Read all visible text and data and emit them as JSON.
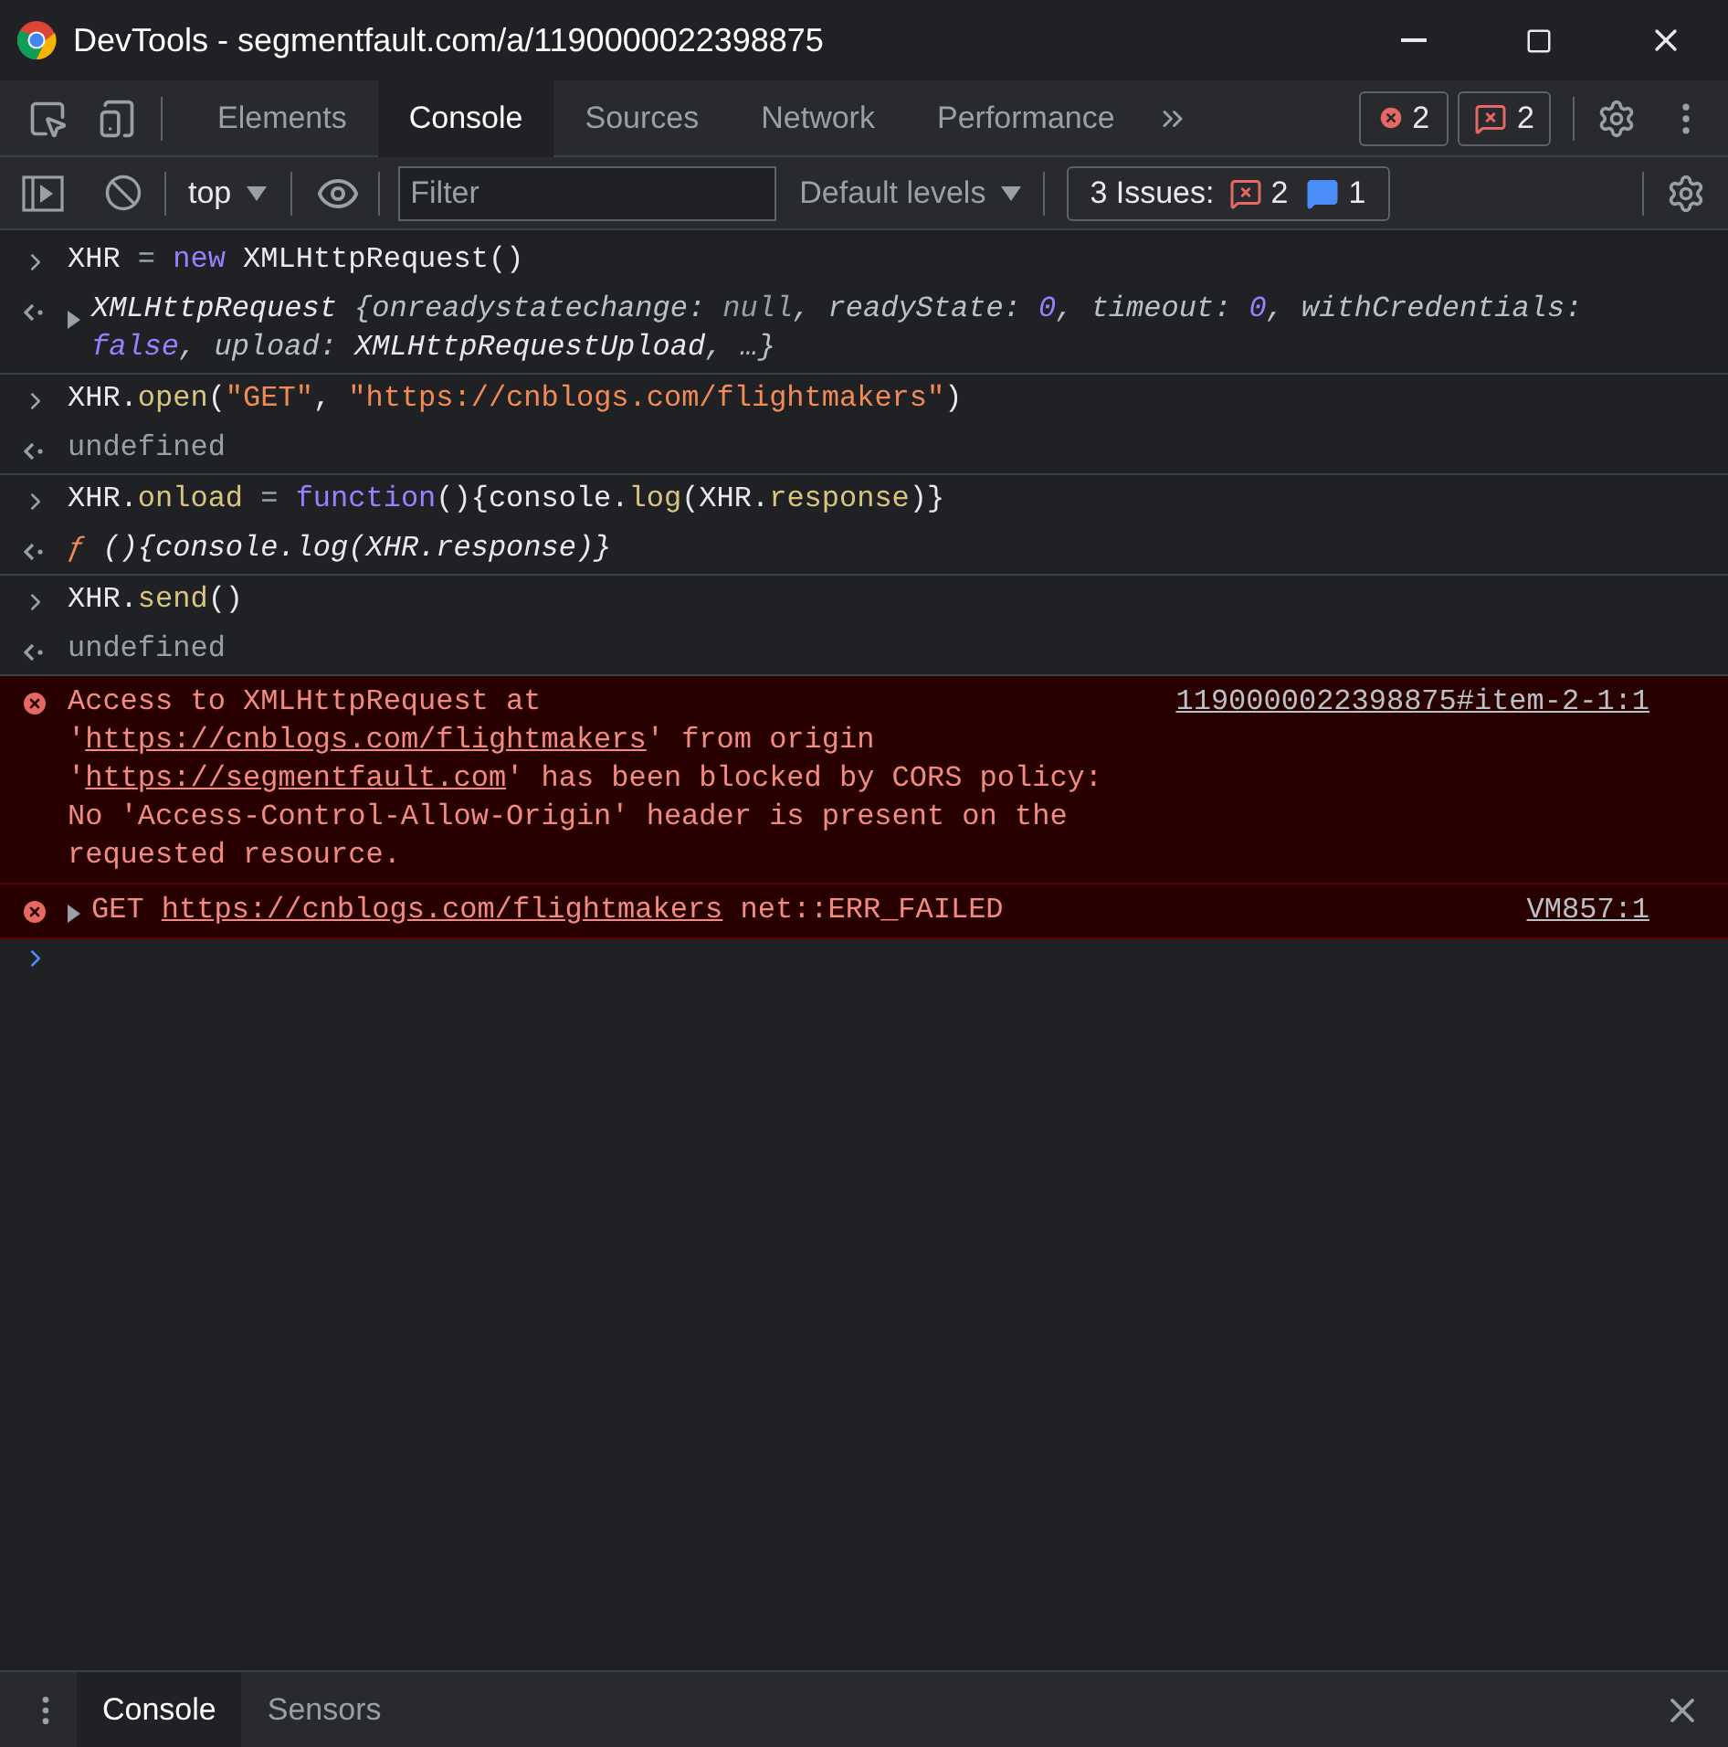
{
  "window": {
    "title": "DevTools - segmentfault.com/a/1190000022398875"
  },
  "toolbar": {
    "tabs": [
      {
        "label": "Elements",
        "selected": false
      },
      {
        "label": "Console",
        "selected": true
      },
      {
        "label": "Sources",
        "selected": false
      },
      {
        "label": "Network",
        "selected": false
      },
      {
        "label": "Performance",
        "selected": false
      }
    ],
    "error_count": "2",
    "issue_count": "2"
  },
  "console_toolbar": {
    "context": "top",
    "filter": {
      "placeholder": "Filter"
    },
    "levels": "Default levels",
    "issues": {
      "label": "3 Issues:",
      "errors": "2",
      "info": "1"
    }
  },
  "entries": [
    {
      "kind": "input",
      "tokens": [
        {
          "kind": "plain",
          "text": "XHR"
        },
        {
          "kind": "op",
          "text": " = "
        },
        {
          "kind": "keyword",
          "text": "new"
        },
        {
          "kind": "plain",
          "text": " XMLHttpRequest()"
        }
      ]
    },
    {
      "kind": "result",
      "expandable": true,
      "italic": true,
      "tokens": [
        {
          "kind": "plain",
          "text": "XMLHttpRequest "
        },
        {
          "kind": "dim",
          "text": "{onreadystatechange: "
        },
        {
          "kind": "null",
          "text": "null"
        },
        {
          "kind": "dim",
          "text": ", readyState: "
        },
        {
          "kind": "number",
          "text": "0"
        },
        {
          "kind": "dim",
          "text": ", timeout: "
        },
        {
          "kind": "number",
          "text": "0"
        },
        {
          "kind": "dim",
          "text": ", withCredentials: "
        },
        {
          "kind": "number",
          "text": "false"
        },
        {
          "kind": "dim",
          "text": ", upload: "
        },
        {
          "kind": "plain",
          "text": "XMLHttpRequestUpload"
        },
        {
          "kind": "dim",
          "text": ", …}"
        }
      ]
    },
    {
      "kind": "input",
      "tokens": [
        {
          "kind": "plain",
          "text": "XHR."
        },
        {
          "kind": "method",
          "text": "open"
        },
        {
          "kind": "plain",
          "text": "("
        },
        {
          "kind": "string",
          "text": "\"GET\""
        },
        {
          "kind": "plain",
          "text": ", "
        },
        {
          "kind": "string",
          "text": "\"https://cnblogs.com/flightmakers\""
        },
        {
          "kind": "plain",
          "text": ")"
        }
      ]
    },
    {
      "kind": "result",
      "expandable": false,
      "italic": false,
      "tokens": [
        {
          "kind": "null",
          "text": "undefined"
        }
      ]
    },
    {
      "kind": "input",
      "tokens": [
        {
          "kind": "plain",
          "text": "XHR."
        },
        {
          "kind": "method",
          "text": "onload"
        },
        {
          "kind": "op",
          "text": " = "
        },
        {
          "kind": "keyword",
          "text": "function"
        },
        {
          "kind": "plain",
          "text": "(){console."
        },
        {
          "kind": "method",
          "text": "log"
        },
        {
          "kind": "plain",
          "text": "(XHR."
        },
        {
          "kind": "method",
          "text": "response"
        },
        {
          "kind": "plain",
          "text": ")}"
        }
      ]
    },
    {
      "kind": "result",
      "expandable": false,
      "italic": true,
      "tokens": [
        {
          "kind": "string",
          "text": "ƒ"
        },
        {
          "kind": "plain",
          "text": " (){console.log(XHR.response)}"
        }
      ]
    },
    {
      "kind": "input",
      "tokens": [
        {
          "kind": "plain",
          "text": "XHR."
        },
        {
          "kind": "method",
          "text": "send"
        },
        {
          "kind": "plain",
          "text": "()"
        }
      ]
    },
    {
      "kind": "result",
      "expandable": false,
      "italic": false,
      "tokens": [
        {
          "kind": "null",
          "text": "undefined"
        }
      ]
    },
    {
      "kind": "error",
      "expandable": false,
      "source": "1190000022398875#item-2-1:1",
      "parts": [
        {
          "kind": "text",
          "text": "Access to XMLHttpRequest at '"
        },
        {
          "kind": "link",
          "text": "https://cnblogs.com/flightmakers"
        },
        {
          "kind": "text",
          "text": "' from origin '"
        },
        {
          "kind": "link",
          "text": "https://segmentfault.com"
        },
        {
          "kind": "text",
          "text": "' has been blocked by CORS policy: No 'Access-Control-Allow-Origin' header is present on the requested resource."
        }
      ]
    },
    {
      "kind": "error",
      "expandable": true,
      "source": "VM857:1",
      "parts": [
        {
          "kind": "text",
          "text": "GET "
        },
        {
          "kind": "link",
          "text": "https://cnblogs.com/flightmakers"
        },
        {
          "kind": "text",
          "text": " net::ERR_FAILED"
        }
      ]
    }
  ],
  "drawer": {
    "tabs": [
      {
        "label": "Console",
        "selected": true
      },
      {
        "label": "Sensors",
        "selected": false
      }
    ]
  }
}
